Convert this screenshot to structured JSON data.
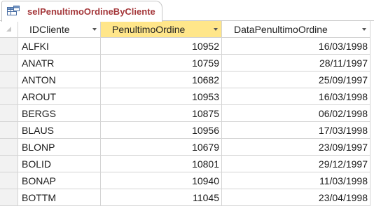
{
  "tab": {
    "title": "selPenultimoOrdineByCliente",
    "icon": "query-datasheet-icon"
  },
  "columns": {
    "id": "IDCliente",
    "order": "PenultimoOrdine",
    "date": "DataPenultimoOrdine"
  },
  "selected_column": "order",
  "colors": {
    "tab_title": "#a4373a",
    "selected_header": "#ffe68a",
    "gridline": "#d4d4d4"
  },
  "rows": [
    {
      "id": "ALFKI",
      "order": "10952",
      "date": "16/03/1998"
    },
    {
      "id": "ANATR",
      "order": "10759",
      "date": "28/11/1997"
    },
    {
      "id": "ANTON",
      "order": "10682",
      "date": "25/09/1997"
    },
    {
      "id": "AROUT",
      "order": "10953",
      "date": "16/03/1998"
    },
    {
      "id": "BERGS",
      "order": "10875",
      "date": "06/02/1998"
    },
    {
      "id": "BLAUS",
      "order": "10956",
      "date": "17/03/1998"
    },
    {
      "id": "BLONP",
      "order": "10679",
      "date": "23/09/1997"
    },
    {
      "id": "BOLID",
      "order": "10801",
      "date": "29/12/1997"
    },
    {
      "id": "BONAP",
      "order": "10940",
      "date": "11/03/1998"
    },
    {
      "id": "BOTTM",
      "order": "11045",
      "date": "23/04/1998"
    }
  ]
}
